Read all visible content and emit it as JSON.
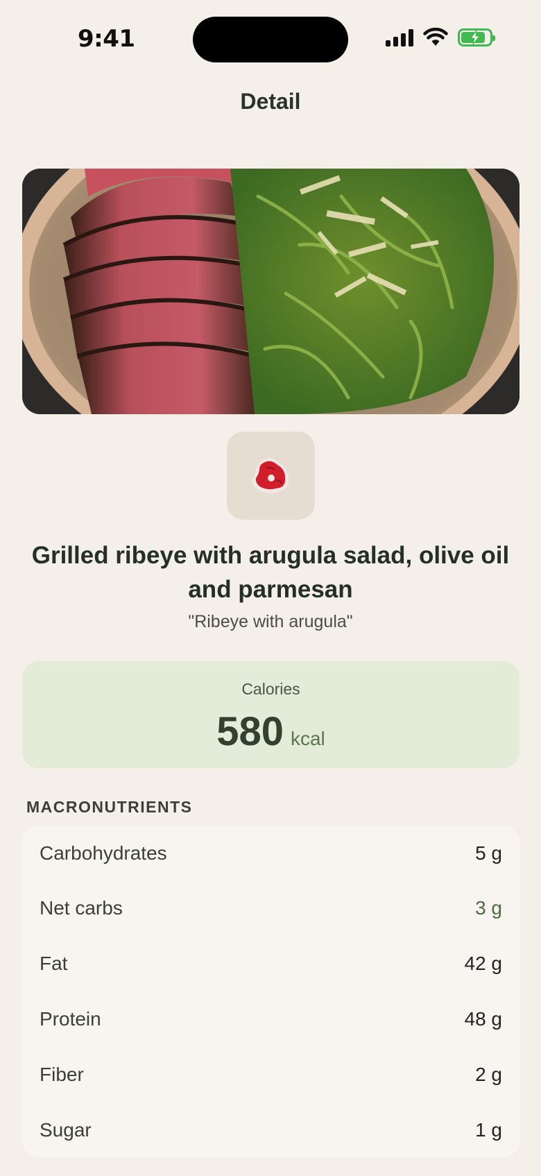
{
  "status_bar": {
    "time": "9:41"
  },
  "nav": {
    "title": "Detail"
  },
  "food": {
    "icon": "steak-icon",
    "name": "Grilled ribeye with arugula salad, olive oil and parmesan",
    "short_name": "\"Ribeye with arugula\""
  },
  "calories": {
    "label": "Calories",
    "value": "580",
    "unit": "kcal"
  },
  "macros": {
    "title": "MACRONUTRIENTS",
    "items": [
      {
        "label": "Carbohydrates",
        "value": "5 g"
      },
      {
        "label": "Net carbs",
        "value": "3 g"
      },
      {
        "label": "Fat",
        "value": "42 g"
      },
      {
        "label": "Protein",
        "value": "48 g"
      },
      {
        "label": "Fiber",
        "value": "2 g"
      },
      {
        "label": "Sugar",
        "value": "1 g"
      }
    ]
  },
  "colors": {
    "background": "#f4efe9",
    "calories_card": "#e3ecd8",
    "accent_green": "#4e6b3e",
    "battery": "#3fb950"
  }
}
